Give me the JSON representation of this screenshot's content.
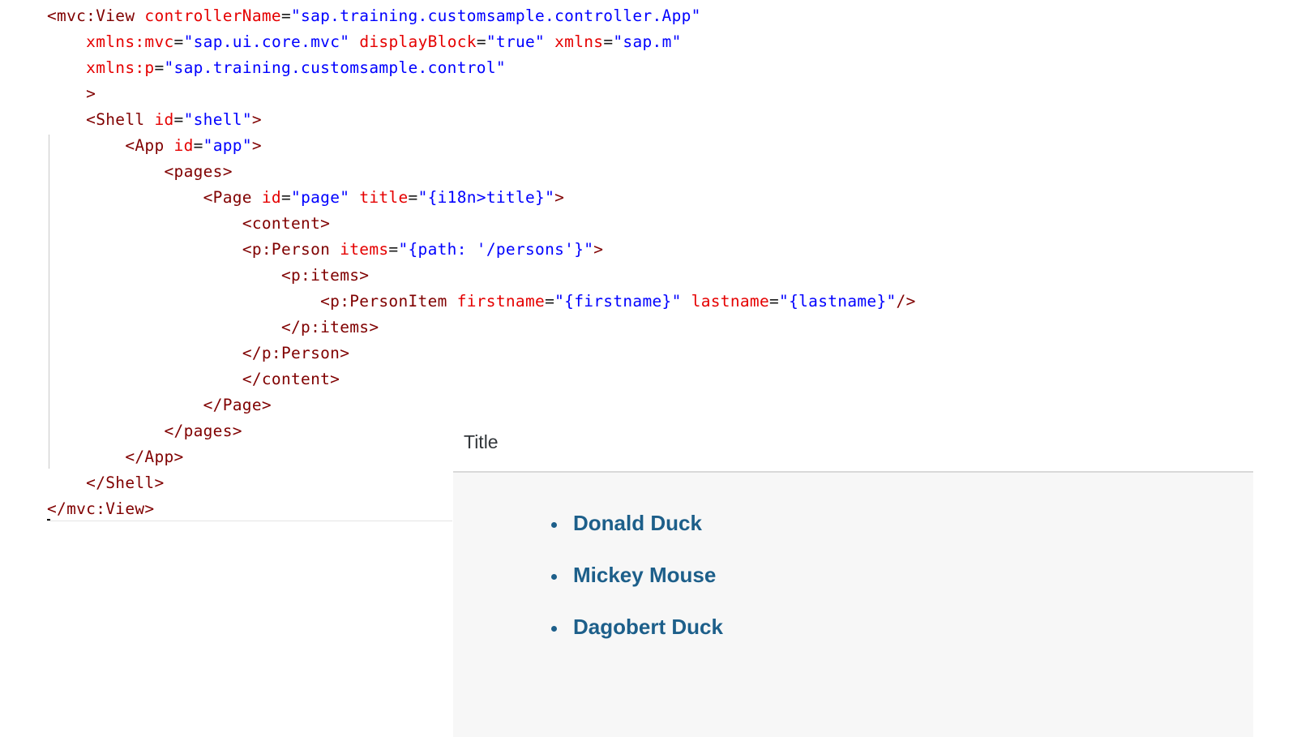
{
  "code": {
    "lines": [
      {
        "indent": 0,
        "tokens": [
          {
            "t": "tag",
            "v": "<mvc:View "
          },
          {
            "t": "attr",
            "v": "controllerName"
          },
          {
            "t": "eq",
            "v": "="
          },
          {
            "t": "val",
            "v": "\"sap.training.customsample.controller.App\""
          }
        ]
      },
      {
        "indent": 1,
        "tokens": [
          {
            "t": "attr",
            "v": "xmlns:mvc"
          },
          {
            "t": "eq",
            "v": "="
          },
          {
            "t": "val",
            "v": "\"sap.ui.core.mvc\" "
          },
          {
            "t": "attr",
            "v": "displayBlock"
          },
          {
            "t": "eq",
            "v": "="
          },
          {
            "t": "val",
            "v": "\"true\" "
          },
          {
            "t": "attr",
            "v": "xmlns"
          },
          {
            "t": "eq",
            "v": "="
          },
          {
            "t": "val",
            "v": "\"sap.m\""
          }
        ]
      },
      {
        "indent": 1,
        "tokens": [
          {
            "t": "attr",
            "v": "xmlns:p"
          },
          {
            "t": "eq",
            "v": "="
          },
          {
            "t": "val",
            "v": "\"sap.training.customsample.control\""
          }
        ]
      },
      {
        "indent": 1,
        "tokens": [
          {
            "t": "tag",
            "v": ">"
          }
        ]
      },
      {
        "indent": 1,
        "tokens": [
          {
            "t": "tag",
            "v": "<Shell "
          },
          {
            "t": "attr",
            "v": "id"
          },
          {
            "t": "eq",
            "v": "="
          },
          {
            "t": "val",
            "v": "\"shell\""
          },
          {
            "t": "tag",
            "v": ">"
          }
        ]
      },
      {
        "indent": 2,
        "tokens": [
          {
            "t": "tag",
            "v": "<App "
          },
          {
            "t": "attr",
            "v": "id"
          },
          {
            "t": "eq",
            "v": "="
          },
          {
            "t": "val",
            "v": "\"app\""
          },
          {
            "t": "tag",
            "v": ">"
          }
        ]
      },
      {
        "indent": 3,
        "tokens": [
          {
            "t": "tag",
            "v": "<pages>"
          }
        ]
      },
      {
        "indent": 4,
        "tokens": [
          {
            "t": "tag",
            "v": "<Page "
          },
          {
            "t": "attr",
            "v": "id"
          },
          {
            "t": "eq",
            "v": "="
          },
          {
            "t": "val",
            "v": "\"page\" "
          },
          {
            "t": "attr",
            "v": "title"
          },
          {
            "t": "eq",
            "v": "="
          },
          {
            "t": "val",
            "v": "\"{i18n>title}\""
          },
          {
            "t": "tag",
            "v": ">"
          }
        ]
      },
      {
        "indent": 5,
        "tokens": [
          {
            "t": "tag",
            "v": "<content>"
          }
        ]
      },
      {
        "indent": 5,
        "tokens": [
          {
            "t": "tag",
            "v": "<p:Person "
          },
          {
            "t": "attr",
            "v": "items"
          },
          {
            "t": "eq",
            "v": "="
          },
          {
            "t": "val",
            "v": "\"{path: '/persons'}\""
          },
          {
            "t": "tag",
            "v": ">"
          }
        ]
      },
      {
        "indent": 6,
        "tokens": [
          {
            "t": "tag",
            "v": "<p:items>"
          }
        ]
      },
      {
        "indent": 7,
        "tokens": [
          {
            "t": "tag",
            "v": "<p:PersonItem "
          },
          {
            "t": "attr",
            "v": "firstname"
          },
          {
            "t": "eq",
            "v": "="
          },
          {
            "t": "val",
            "v": "\"{firstname}\" "
          },
          {
            "t": "attr",
            "v": "lastname"
          },
          {
            "t": "eq",
            "v": "="
          },
          {
            "t": "val",
            "v": "\"{lastname}\""
          },
          {
            "t": "tag",
            "v": "/>"
          }
        ]
      },
      {
        "indent": 6,
        "tokens": [
          {
            "t": "tag",
            "v": "</p:items>"
          }
        ]
      },
      {
        "indent": 5,
        "tokens": [
          {
            "t": "tag",
            "v": "</p:Person>"
          }
        ]
      },
      {
        "indent": 5,
        "tokens": [
          {
            "t": "tag",
            "v": "</content>"
          }
        ]
      },
      {
        "indent": 4,
        "tokens": [
          {
            "t": "tag",
            "v": "</Page>"
          }
        ]
      },
      {
        "indent": 3,
        "tokens": [
          {
            "t": "tag",
            "v": "</pages>"
          }
        ]
      },
      {
        "indent": 2,
        "tokens": [
          {
            "t": "tag",
            "v": "</App>"
          }
        ]
      },
      {
        "indent": 1,
        "tokens": [
          {
            "t": "tag",
            "v": "</Shell>"
          }
        ]
      },
      {
        "indent": 0,
        "tokens": [
          {
            "t": "tag",
            "v": "</mvc:View>"
          }
        ]
      }
    ]
  },
  "preview": {
    "title": "Title",
    "persons": [
      "Donald Duck",
      "Mickey Mouse",
      "Dagobert Duck"
    ]
  },
  "colors": {
    "tag": "#800000",
    "attribute": "#e50000",
    "value": "#0000ff",
    "link": "#1d5f8a",
    "content_background": "#f7f7f7"
  }
}
